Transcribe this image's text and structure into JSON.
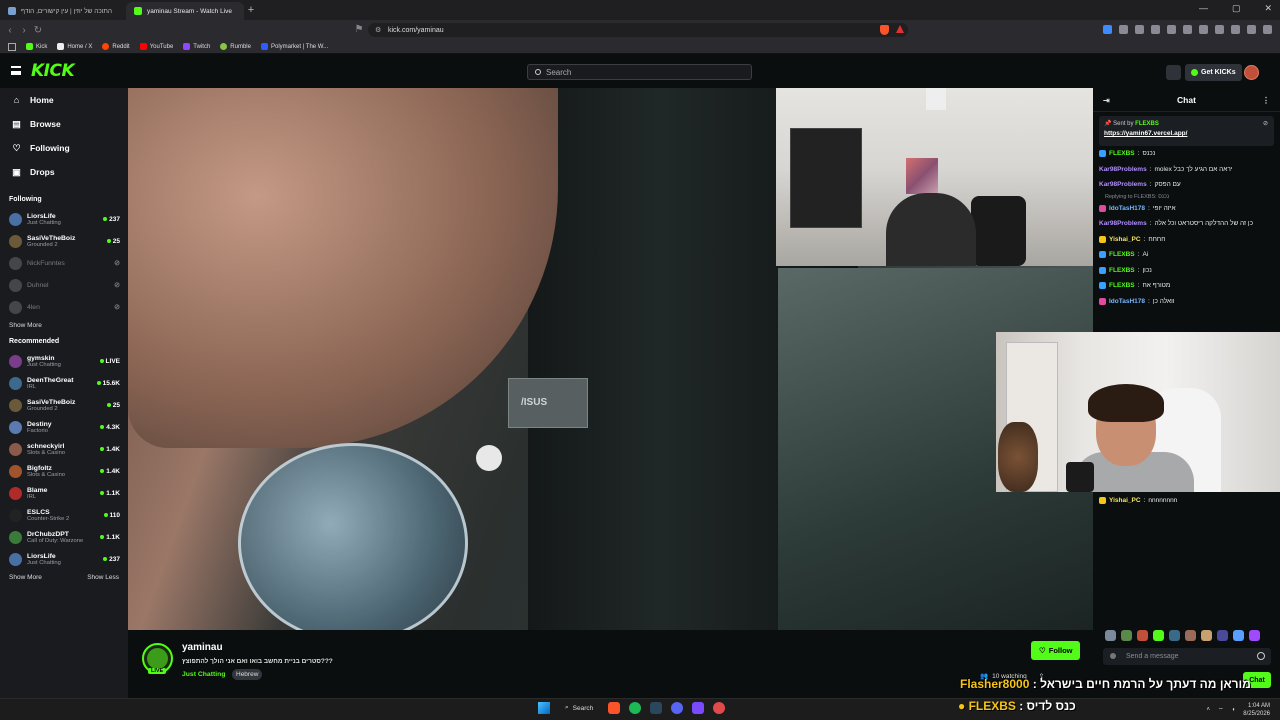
{
  "browser": {
    "tabs": [
      {
        "title": "התוכה של יוזין | עין קישורים, הודף"
      },
      {
        "title": "yaminau Stream - Watch Live"
      }
    ],
    "url": "kick.com/yaminau",
    "bookmarks": [
      "Kick",
      "Home / X",
      "Reddit",
      "YouTube",
      "Twitch",
      "Rumble",
      "Polymarket | The W..."
    ]
  },
  "header": {
    "logo": "KICK",
    "search_placeholder": "Search",
    "get_kicks": "Get KICKs"
  },
  "sidebar": {
    "nav": [
      {
        "label": "Home",
        "icon": "home-icon"
      },
      {
        "label": "Browse",
        "icon": "browse-icon"
      },
      {
        "label": "Following",
        "icon": "heart-icon"
      },
      {
        "label": "Drops",
        "icon": "drops-icon"
      }
    ],
    "following_title": "Following",
    "following": [
      {
        "name": "LiorsLife",
        "category": "Just Chatting",
        "viewers": "237",
        "online": true,
        "color": "#4a6fa5"
      },
      {
        "name": "SasiVeTheBoiz",
        "category": "Grounded 2",
        "viewers": "25",
        "online": true,
        "color": "#6a5a3a"
      },
      {
        "name": "NickFunntes",
        "category": "",
        "viewers": "",
        "online": false,
        "color": "#888"
      },
      {
        "name": "Duhnel",
        "category": "",
        "viewers": "",
        "online": false,
        "color": "#888"
      },
      {
        "name": "4len",
        "category": "",
        "viewers": "",
        "online": false,
        "color": "#888"
      }
    ],
    "show_more": "Show More",
    "recommended_title": "Recommended",
    "recommended": [
      {
        "name": "gymskin",
        "category": "Just Chatting",
        "viewers": "LIVE",
        "color": "#7a3d8a"
      },
      {
        "name": "DeenTheGreat",
        "category": "IRL",
        "viewers": "15.6K",
        "color": "#3d6a8a"
      },
      {
        "name": "SasiVeTheBoiz",
        "category": "Grounded 2",
        "viewers": "25",
        "color": "#6a5a3a"
      },
      {
        "name": "Destiny",
        "category": "Factorio",
        "viewers": "4.3K",
        "color": "#5a7ab0"
      },
      {
        "name": "schneckyirl",
        "category": "Slots & Casino",
        "viewers": "1.4K",
        "color": "#8a5a4a"
      },
      {
        "name": "Bigfoltz",
        "category": "Slots & Casino",
        "viewers": "1.4K",
        "color": "#a0542e"
      },
      {
        "name": "Blame",
        "category": "IRL",
        "viewers": "1.1K",
        "color": "#b02a2a"
      },
      {
        "name": "ESLCS",
        "category": "Counter-Strike 2",
        "viewers": "110",
        "color": "#222"
      },
      {
        "name": "DrChubzDPT",
        "category": "Call of Duty: Warzone",
        "viewers": "1.1K",
        "color": "#3a7a3a"
      },
      {
        "name": "LiorsLife",
        "category": "Just Chatting",
        "viewers": "237",
        "color": "#4a6fa5"
      }
    ],
    "show_more_2": "Show More",
    "show_less": "Show Less"
  },
  "stream": {
    "name": "yaminau",
    "title": "???סטרים בניית מחשב בואו ואם אני הולך להתפוצץ",
    "category": "Just Chatting",
    "tag": "Hebrew",
    "live_label": "LIVE",
    "follow": "Follow",
    "watching": "10 watching"
  },
  "chat": {
    "title": "Chat",
    "pinned_sent_by": "Sent by",
    "pinned_user": "FLEXBS",
    "pinned_link": "https://yamin67.vercel.app/",
    "messages": [
      {
        "user": "FLEXBS",
        "text": "נכנס",
        "color": "#53fc18",
        "badge": "#3aa0ff"
      },
      {
        "user": "Kar98Problems",
        "text": "molex יראה אם הגיע לך כבל",
        "color": "#b18cff",
        "badge": ""
      },
      {
        "user": "Kar98Problems",
        "text": "עם הפסק",
        "color": "#b18cff",
        "badge": ""
      },
      {
        "user": "IdoTasH178",
        "text": "איזה יופי",
        "color": "#7ab8ff",
        "badge": "#e24aa0",
        "reply": "Replying to FLEXBS: נכנס"
      },
      {
        "user": "Kar98Problems",
        "text": "כן זה של ההדלקה ריסטראט וכל אלה",
        "color": "#b18cff",
        "badge": ""
      },
      {
        "user": "Yishai_PC",
        "text": "חחחח",
        "color": "#f5e663",
        "badge": "#f5c518"
      },
      {
        "user": "FLEXBS",
        "text": "Ai",
        "color": "#53fc18",
        "badge": "#3aa0ff"
      },
      {
        "user": "FLEXBS",
        "text": "נכון",
        "color": "#53fc18",
        "badge": "#3aa0ff"
      },
      {
        "user": "FLEXBS",
        "text": "מטורף אח",
        "color": "#53fc18",
        "badge": "#3aa0ff"
      },
      {
        "user": "IdoTasH178",
        "text": "וואלה כן",
        "color": "#7ab8ff",
        "badge": "#e24aa0"
      }
    ],
    "last_message": {
      "user": "Yishai_PC",
      "text": "nnnnnnnn",
      "color": "#f5e663",
      "badge": "#f5c518"
    },
    "input_placeholder": "Send a message",
    "chat_button": "Chat"
  },
  "overlay": {
    "ticker_prefix": "Flasher8000",
    "ticker_text": ": מוראן מה דעתך על הרמת חיים בישראל",
    "ticker2_user": "FLEXBS",
    "ticker2_text": ": כנס לדיס"
  },
  "taskbar": {
    "search": "Search",
    "time": "1:04 AM",
    "date": "8/25/2026"
  }
}
